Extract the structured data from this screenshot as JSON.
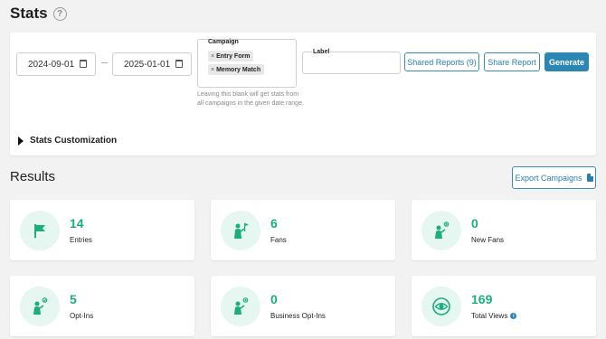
{
  "page": {
    "title": "Stats",
    "help_icon": "question-circle-icon"
  },
  "filters": {
    "start_date": "2024-09-01",
    "end_date": "2025-01-01",
    "calendar_icon": "calendar-icon",
    "campaign": {
      "label": "Campaign",
      "selected": [
        "Entry Form",
        "Memory Match"
      ],
      "remove_glyph": "×",
      "help_text": "Leaving this blank will get stats from all campaigns in the given date range."
    },
    "label_field": {
      "label": "Label",
      "value": ""
    },
    "shared_reports_label": "Shared Reports (9)",
    "share_report_label": "Share Report",
    "generate_label": "Generate"
  },
  "customization": {
    "label": "Stats Customization",
    "icon": "caret-right-icon"
  },
  "results": {
    "title": "Results",
    "export_label": "Export Campaigns",
    "export_icon": "document-icon",
    "cards": [
      {
        "value": "14",
        "label": "Entries",
        "icon": "flag-icon"
      },
      {
        "value": "6",
        "label": "Fans",
        "icon": "person-flag-icon"
      },
      {
        "value": "0",
        "label": "New Fans",
        "icon": "new-fan-icon"
      },
      {
        "value": "5",
        "label": "Opt-Ins",
        "icon": "opt-in-icon"
      },
      {
        "value": "0",
        "label": "Business Opt-Ins",
        "icon": "business-opt-in-icon"
      },
      {
        "value": "169",
        "label": "Total Views",
        "icon": "eye-icon",
        "info_icon": "info-icon"
      }
    ]
  },
  "colors": {
    "accent": "#2c86b3",
    "success": "#1bae7b",
    "icon_bg": "#e6f6f0"
  }
}
